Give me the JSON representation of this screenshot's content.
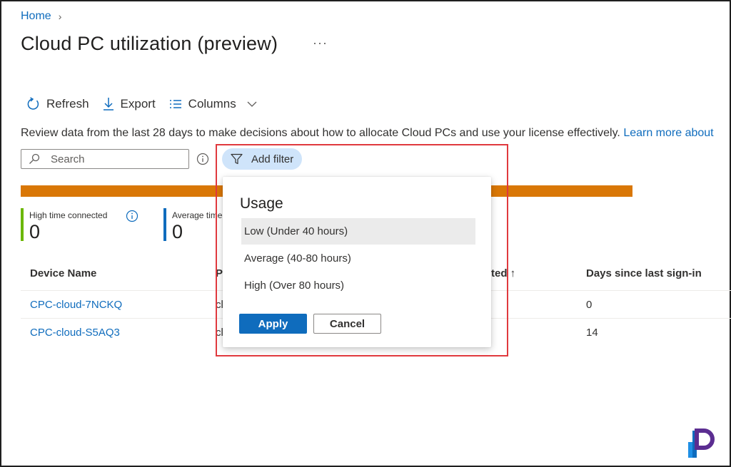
{
  "breadcrumb": {
    "home": "Home",
    "separator": "›"
  },
  "page": {
    "title": "Cloud PC utilization (preview)",
    "more": "···"
  },
  "toolbar": {
    "refresh": "Refresh",
    "export": "Export",
    "columns": "Columns"
  },
  "info": {
    "text": "Review data from the last 28 days to make decisions about how to allocate Cloud PCs and use your license effectively. ",
    "link": "Learn more about"
  },
  "search": {
    "placeholder": "Search"
  },
  "filter": {
    "label": "Add filter"
  },
  "stats": [
    {
      "label": "High time connected",
      "value": "0",
      "color": "#6bb700"
    },
    {
      "label": "Average time",
      "value": "0",
      "color": "#0f6cbd"
    }
  ],
  "table": {
    "columns": [
      "Device Name",
      "P",
      "ted ↑",
      "Days since last sign-in"
    ],
    "rows": [
      {
        "device": "CPC-cloud-7NCKQ",
        "partial": "cl",
        "days": "0"
      },
      {
        "device": "CPC-cloud-S5AQ3",
        "partial": "cl",
        "days": "14"
      }
    ]
  },
  "popup": {
    "heading": "Usage",
    "options": [
      {
        "label": "Low (Under 40 hours)",
        "selected": true
      },
      {
        "label": "Average (40-80 hours)",
        "selected": false
      },
      {
        "label": "High (Over 80 hours)",
        "selected": false
      }
    ],
    "apply": "Apply",
    "cancel": "Cancel"
  },
  "colors": {
    "accent": "#0f6cbd",
    "highlight": "#e0393e",
    "bar": "#d97706"
  }
}
